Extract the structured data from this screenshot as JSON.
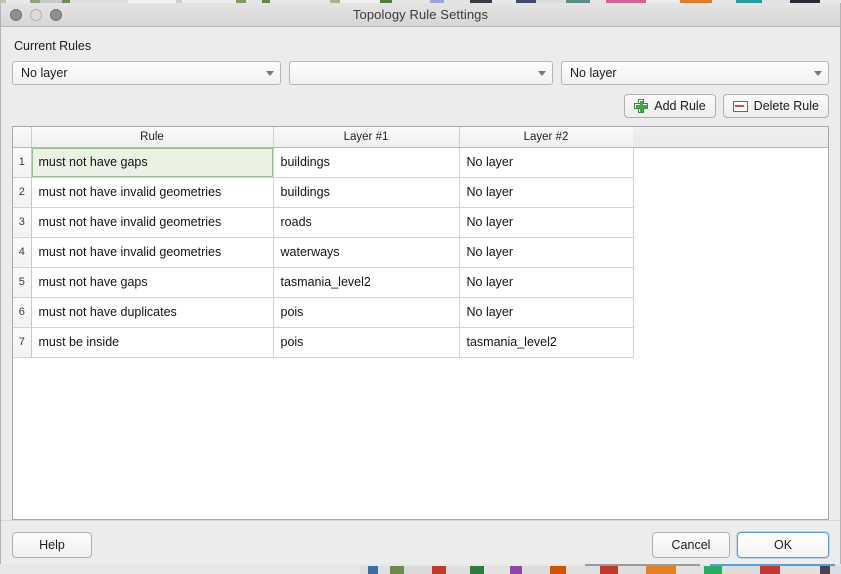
{
  "window": {
    "title": "Topology Rule Settings",
    "traffic_lights": [
      "close",
      "minimize",
      "maximize"
    ]
  },
  "current_rules": {
    "group_label": "Current Rules",
    "combos": [
      {
        "name": "rule-layer1-combo",
        "value": "No layer"
      },
      {
        "name": "rule-type-combo",
        "value": ""
      },
      {
        "name": "rule-layer2-combo",
        "value": "No layer"
      }
    ],
    "add_rule_label": "Add Rule",
    "delete_rule_label": "Delete Rule"
  },
  "table": {
    "columns": [
      "Rule",
      "Layer #1",
      "Layer #2"
    ],
    "rows": [
      {
        "num": "1",
        "rule": "must not have gaps",
        "layer1": "buildings",
        "layer2": "No layer",
        "selected": true
      },
      {
        "num": "2",
        "rule": "must not have invalid geometries",
        "layer1": "buildings",
        "layer2": "No layer",
        "selected": false
      },
      {
        "num": "3",
        "rule": "must not have invalid geometries",
        "layer1": "roads",
        "layer2": "No layer",
        "selected": false
      },
      {
        "num": "4",
        "rule": "must not have invalid geometries",
        "layer1": "waterways",
        "layer2": "No layer",
        "selected": false
      },
      {
        "num": "5",
        "rule": "must not have gaps",
        "layer1": "tasmania_level2",
        "layer2": "No layer",
        "selected": false
      },
      {
        "num": "6",
        "rule": "must not have duplicates",
        "layer1": "pois",
        "layer2": "No layer",
        "selected": false
      },
      {
        "num": "7",
        "rule": "must be inside",
        "layer1": "pois",
        "layer2": "tasmania_level2",
        "selected": false
      }
    ]
  },
  "footer": {
    "help_label": "Help",
    "cancel_label": "Cancel",
    "ok_label": "OK"
  },
  "colors": {
    "selection_green_bg": "#e9f2e3",
    "selection_green_border": "#9bbd92",
    "default_button_blue": "#5b9bd5",
    "add_icon_green": "#4aa34a",
    "delete_icon_red": "#d94a4a"
  }
}
